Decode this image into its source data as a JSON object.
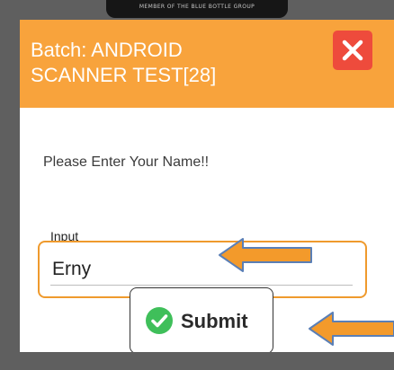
{
  "header_badge": {
    "text": "MEMBER OF THE BLUE BOTTLE GROUP"
  },
  "dialog": {
    "title_line1": "Batch: ANDROID",
    "title_line2": "SCANNER TEST[28]",
    "close_icon": "close-x-icon",
    "prompt": "Please Enter Your Name!!",
    "input_label": "Input",
    "input_value": "Erny",
    "submit_label": "Submit",
    "submit_icon": "check-circle-icon"
  },
  "colors": {
    "header": "#f8a33c",
    "close_button": "#ee4b3c",
    "input_border": "#ef9a2d",
    "check_icon": "#3fbf5a",
    "arrow": "#f39a2b"
  }
}
